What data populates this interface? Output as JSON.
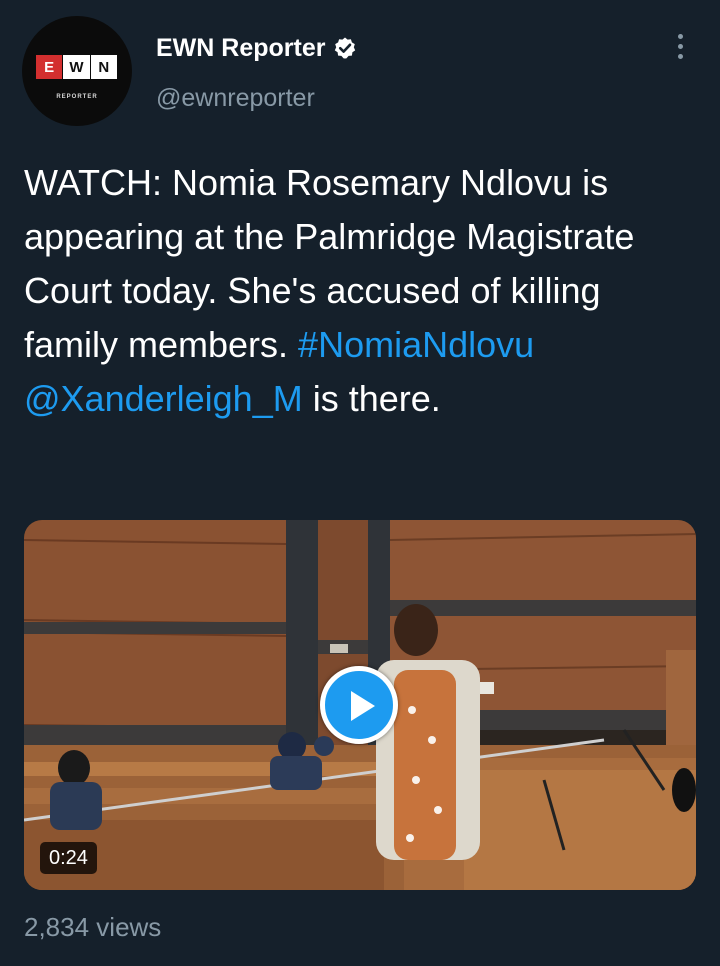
{
  "account": {
    "display_name": "EWN Reporter",
    "handle": "@ewnreporter",
    "verified": true,
    "verified_icon": "verified-badge-icon",
    "avatar": {
      "logo_letters": [
        "E",
        "W",
        "N"
      ],
      "logo_subtext": "REPORTER",
      "logo_colors": [
        "#d32f2f",
        "#ffffff",
        "#ffffff"
      ]
    }
  },
  "menu_icon": "more-options-icon",
  "tweet": {
    "segments": [
      {
        "text": "WATCH: Nomia Rosemary Ndlovu is appearing at the Palmridge Magistrate Court today. She's accused of killing family members. ",
        "type": "text"
      },
      {
        "text": "#NomiaNdlovu",
        "type": "hashtag"
      },
      {
        "text": " ",
        "type": "text"
      },
      {
        "text": "@Xanderleigh_M",
        "type": "mention"
      },
      {
        "text": " is there.",
        "type": "text"
      }
    ]
  },
  "video": {
    "duration": "0:24",
    "play_icon": "play-icon"
  },
  "views": "2,834 views",
  "colors": {
    "background": "#15202b",
    "text": "#ffffff",
    "secondary": "#8899a6",
    "accent": "#1d9bf0"
  }
}
